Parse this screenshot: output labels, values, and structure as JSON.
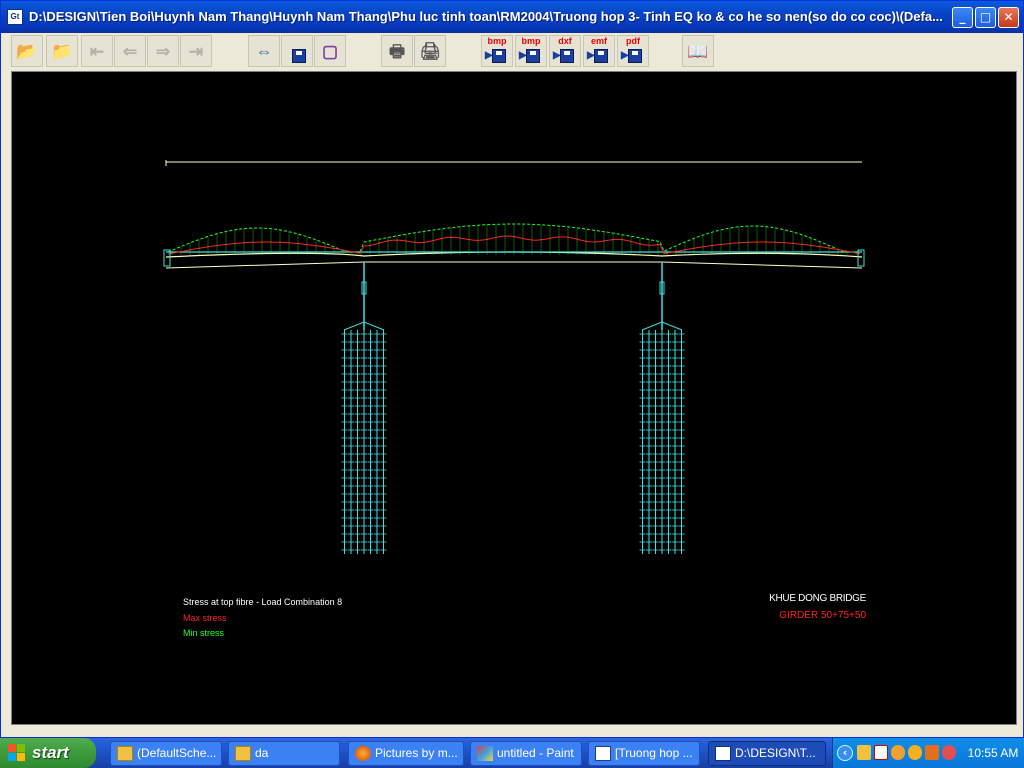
{
  "window": {
    "icon_label": "Gt",
    "title": "D:\\DESIGN\\Tien Boi\\Huynh Nam Thang\\Huynh Nam Thang\\Phu luc tinh toan\\RM2004\\Truong hop 3- Tinh EQ ko & co he so nen(so do co coc)\\(Defa...",
    "minimize_label": "_",
    "maximize_label": "□",
    "close_label": "✕"
  },
  "toolbar": {
    "export_labels": [
      "bmp",
      "bmp",
      "dxf",
      "emf",
      "pdf"
    ]
  },
  "drawing": {
    "legend_title": "Stress at top fibre - Load Combination 8",
    "legend_max": "Max stress",
    "legend_min": "Min stress",
    "bridge_name": "KHUE DONG BRIDGE",
    "girder": "GIRDER 50+75+50",
    "colors": {
      "max_stress": "#ff2020",
      "min_stress": "#20ff20",
      "structure": "#40e0e0",
      "deck": "#ffffc0"
    }
  },
  "taskbar": {
    "start_label": "start",
    "tasks": [
      {
        "label": "(DefaultSche...",
        "icon": "folder-icon"
      },
      {
        "label": "da",
        "icon": "folder-icon"
      },
      {
        "label": "Pictures by m...",
        "icon": "firefox-icon"
      },
      {
        "label": "untitled - Paint",
        "icon": "paint-icon"
      },
      {
        "label": "[Truong hop ...",
        "icon": "rm-icon"
      },
      {
        "label": "D:\\DESIGN\\T...",
        "icon": "gt-icon"
      }
    ],
    "clock": "10:55 AM"
  }
}
